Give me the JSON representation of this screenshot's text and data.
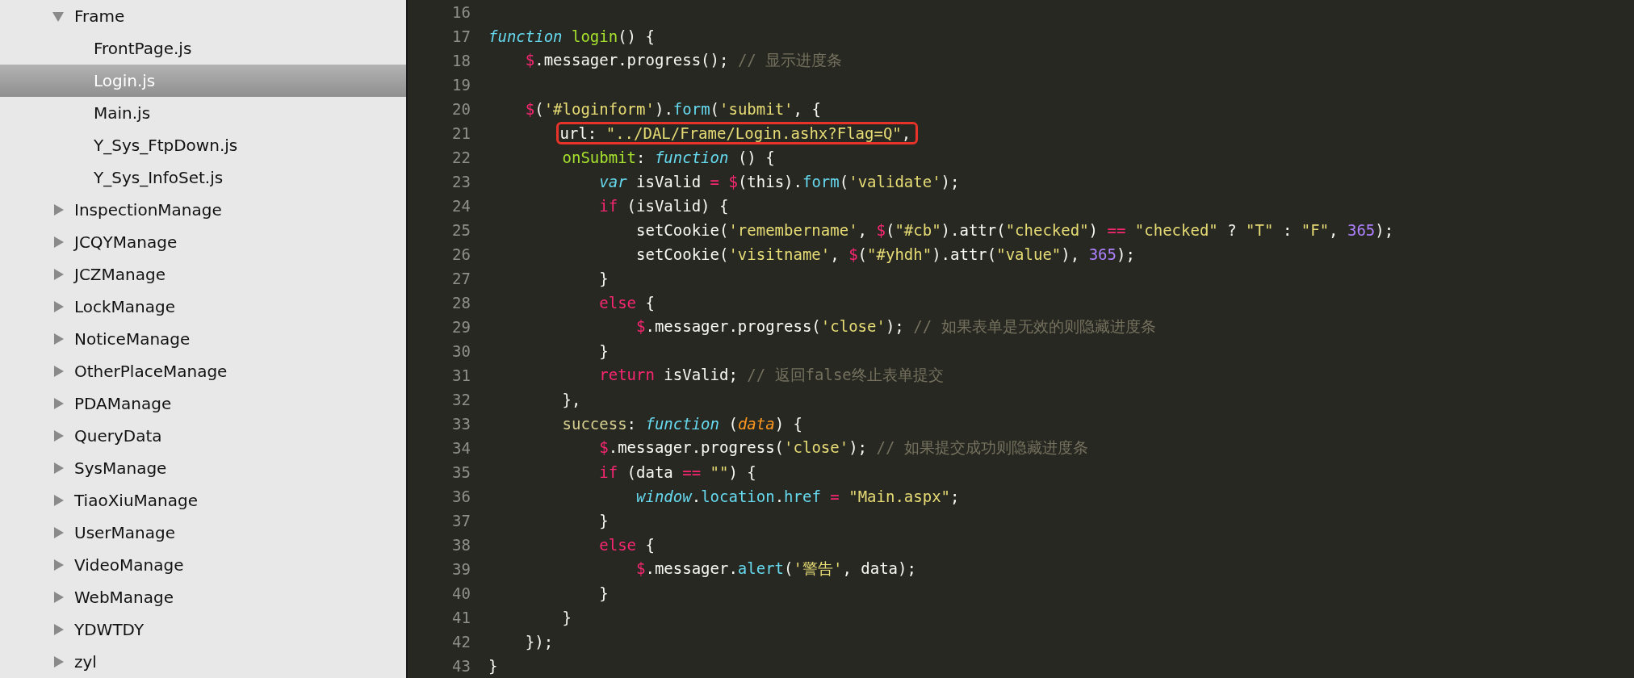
{
  "sidebar": {
    "tree": [
      {
        "label": "Frame",
        "kind": "folder",
        "expanded": true,
        "children": [
          {
            "label": "FrontPage.js",
            "kind": "file",
            "selected": false
          },
          {
            "label": "Login.js",
            "kind": "file",
            "selected": true
          },
          {
            "label": "Main.js",
            "kind": "file",
            "selected": false
          },
          {
            "label": "Y_Sys_FtpDown.js",
            "kind": "file",
            "selected": false
          },
          {
            "label": "Y_Sys_InfoSet.js",
            "kind": "file",
            "selected": false
          }
        ]
      },
      {
        "label": "InspectionManage",
        "kind": "folder",
        "expanded": false
      },
      {
        "label": "JCQYManage",
        "kind": "folder",
        "expanded": false
      },
      {
        "label": "JCZManage",
        "kind": "folder",
        "expanded": false
      },
      {
        "label": "LockManage",
        "kind": "folder",
        "expanded": false
      },
      {
        "label": "NoticeManage",
        "kind": "folder",
        "expanded": false
      },
      {
        "label": "OtherPlaceManage",
        "kind": "folder",
        "expanded": false
      },
      {
        "label": "PDAManage",
        "kind": "folder",
        "expanded": false
      },
      {
        "label": "QueryData",
        "kind": "folder",
        "expanded": false
      },
      {
        "label": "SysManage",
        "kind": "folder",
        "expanded": false
      },
      {
        "label": "TiaoXiuManage",
        "kind": "folder",
        "expanded": false
      },
      {
        "label": "UserManage",
        "kind": "folder",
        "expanded": false
      },
      {
        "label": "VideoManage",
        "kind": "folder",
        "expanded": false
      },
      {
        "label": "WebManage",
        "kind": "folder",
        "expanded": false
      },
      {
        "label": "YDWTDY",
        "kind": "folder",
        "expanded": false
      },
      {
        "label": "zyl",
        "kind": "folder",
        "expanded": false
      }
    ]
  },
  "editor": {
    "lines": [
      {
        "number": "16"
      },
      {
        "number": "17",
        "tokens": [
          {
            "t": "function",
            "kind": "storage"
          },
          {
            "t": " login",
            "kind": "entity"
          },
          {
            "t": "() {",
            "kind": "plain"
          }
        ]
      },
      {
        "number": "18",
        "tokens": [
          {
            "t": "    $",
            "kind": "keyword"
          },
          {
            "t": ".messager.progress(); ",
            "kind": "plain"
          },
          {
            "t": "// 显示进度条",
            "kind": "comment"
          }
        ]
      },
      {
        "number": "19"
      },
      {
        "number": "20",
        "tokens": [
          {
            "t": "    $",
            "kind": "keyword"
          },
          {
            "t": "(",
            "kind": "plain"
          },
          {
            "t": "'#loginform'",
            "kind": "string"
          },
          {
            "t": ").",
            "kind": "plain"
          },
          {
            "t": "form",
            "kind": "support"
          },
          {
            "t": "(",
            "kind": "plain"
          },
          {
            "t": "'submit'",
            "kind": "string"
          },
          {
            "t": ", {",
            "kind": "plain"
          }
        ]
      },
      {
        "number": "21",
        "annotated": true,
        "tokens": [
          {
            "t": "        url: ",
            "kind": "plain"
          },
          {
            "t": "\"../DAL/Frame/Login.ashx?Flag=Q\"",
            "kind": "string"
          },
          {
            "t": ",",
            "kind": "plain"
          }
        ]
      },
      {
        "number": "22",
        "tokens": [
          {
            "t": "        onSubmit",
            "kind": "entity"
          },
          {
            "t": ": ",
            "kind": "plain"
          },
          {
            "t": "function",
            "kind": "storage"
          },
          {
            "t": " () {",
            "kind": "plain"
          }
        ]
      },
      {
        "number": "23",
        "tokens": [
          {
            "t": "            var",
            "kind": "storage"
          },
          {
            "t": " isValid ",
            "kind": "plain"
          },
          {
            "t": "=",
            "kind": "keyword"
          },
          {
            "t": " $",
            "kind": "keyword"
          },
          {
            "t": "(this).",
            "kind": "plain"
          },
          {
            "t": "form",
            "kind": "support"
          },
          {
            "t": "(",
            "kind": "plain"
          },
          {
            "t": "'validate'",
            "kind": "string"
          },
          {
            "t": ");",
            "kind": "plain"
          }
        ]
      },
      {
        "number": "24",
        "tokens": [
          {
            "t": "            if",
            "kind": "keyword"
          },
          {
            "t": " (isValid) {",
            "kind": "plain"
          }
        ]
      },
      {
        "number": "25",
        "tokens": [
          {
            "t": "                setCookie(",
            "kind": "plain"
          },
          {
            "t": "'remembername'",
            "kind": "string"
          },
          {
            "t": ", ",
            "kind": "plain"
          },
          {
            "t": "$",
            "kind": "keyword"
          },
          {
            "t": "(",
            "kind": "plain"
          },
          {
            "t": "\"#cb\"",
            "kind": "string"
          },
          {
            "t": ").attr(",
            "kind": "plain"
          },
          {
            "t": "\"checked\"",
            "kind": "string"
          },
          {
            "t": ") ",
            "kind": "plain"
          },
          {
            "t": "==",
            "kind": "keyword"
          },
          {
            "t": " \"checked\"",
            "kind": "string"
          },
          {
            "t": " ? ",
            "kind": "plain"
          },
          {
            "t": "\"T\"",
            "kind": "string"
          },
          {
            "t": " : ",
            "kind": "plain"
          },
          {
            "t": "\"F\"",
            "kind": "string"
          },
          {
            "t": ", ",
            "kind": "plain"
          },
          {
            "t": "365",
            "kind": "number"
          },
          {
            "t": ");",
            "kind": "plain"
          }
        ]
      },
      {
        "number": "26",
        "tokens": [
          {
            "t": "                setCookie(",
            "kind": "plain"
          },
          {
            "t": "'visitname'",
            "kind": "string"
          },
          {
            "t": ", ",
            "kind": "plain"
          },
          {
            "t": "$",
            "kind": "keyword"
          },
          {
            "t": "(",
            "kind": "plain"
          },
          {
            "t": "\"#yhdh\"",
            "kind": "string"
          },
          {
            "t": ").attr(",
            "kind": "plain"
          },
          {
            "t": "\"value\"",
            "kind": "string"
          },
          {
            "t": "), ",
            "kind": "plain"
          },
          {
            "t": "365",
            "kind": "number"
          },
          {
            "t": ");",
            "kind": "plain"
          }
        ]
      },
      {
        "number": "27",
        "tokens": [
          {
            "t": "            }",
            "kind": "plain"
          }
        ]
      },
      {
        "number": "28",
        "tokens": [
          {
            "t": "            else",
            "kind": "keyword"
          },
          {
            "t": " {",
            "kind": "plain"
          }
        ]
      },
      {
        "number": "29",
        "tokens": [
          {
            "t": "                $",
            "kind": "keyword"
          },
          {
            "t": ".messager.progress(",
            "kind": "plain"
          },
          {
            "t": "'close'",
            "kind": "string"
          },
          {
            "t": "); ",
            "kind": "plain"
          },
          {
            "t": "// 如果表单是无效的则隐藏进度条",
            "kind": "comment"
          }
        ]
      },
      {
        "number": "30",
        "tokens": [
          {
            "t": "            }",
            "kind": "plain"
          }
        ]
      },
      {
        "number": "31",
        "tokens": [
          {
            "t": "            return",
            "kind": "keyword"
          },
          {
            "t": " isValid; ",
            "kind": "plain"
          },
          {
            "t": "// 返回false终止表单提交",
            "kind": "comment"
          }
        ]
      },
      {
        "number": "32",
        "tokens": [
          {
            "t": "        },",
            "kind": "plain"
          }
        ]
      },
      {
        "number": "33",
        "tokens": [
          {
            "t": "        success",
            "kind": "label"
          },
          {
            "t": ": ",
            "kind": "plain"
          },
          {
            "t": "function",
            "kind": "storage"
          },
          {
            "t": " (",
            "kind": "plain"
          },
          {
            "t": "data",
            "kind": "param"
          },
          {
            "t": ") {",
            "kind": "plain"
          }
        ]
      },
      {
        "number": "34",
        "tokens": [
          {
            "t": "            $",
            "kind": "keyword"
          },
          {
            "t": ".messager.progress(",
            "kind": "plain"
          },
          {
            "t": "'close'",
            "kind": "string"
          },
          {
            "t": "); ",
            "kind": "plain"
          },
          {
            "t": "// 如果提交成功则隐藏进度条",
            "kind": "comment"
          }
        ]
      },
      {
        "number": "35",
        "tokens": [
          {
            "t": "            if",
            "kind": "keyword"
          },
          {
            "t": " (data ",
            "kind": "plain"
          },
          {
            "t": "==",
            "kind": "keyword"
          },
          {
            "t": " \"\"",
            "kind": "string"
          },
          {
            "t": ") {",
            "kind": "plain"
          }
        ]
      },
      {
        "number": "36",
        "tokens": [
          {
            "t": "                window",
            "kind": "storage"
          },
          {
            "t": ".",
            "kind": "plain"
          },
          {
            "t": "location",
            "kind": "support"
          },
          {
            "t": ".",
            "kind": "plain"
          },
          {
            "t": "href",
            "kind": "support"
          },
          {
            "t": " =",
            "kind": "keyword"
          },
          {
            "t": " \"Main.aspx\"",
            "kind": "string"
          },
          {
            "t": ";",
            "kind": "plain"
          }
        ]
      },
      {
        "number": "37",
        "tokens": [
          {
            "t": "            }",
            "kind": "plain"
          }
        ]
      },
      {
        "number": "38",
        "tokens": [
          {
            "t": "            else",
            "kind": "keyword"
          },
          {
            "t": " {",
            "kind": "plain"
          }
        ]
      },
      {
        "number": "39",
        "tokens": [
          {
            "t": "                $",
            "kind": "keyword"
          },
          {
            "t": ".messager.",
            "kind": "plain"
          },
          {
            "t": "alert",
            "kind": "support"
          },
          {
            "t": "(",
            "kind": "plain"
          },
          {
            "t": "'警告'",
            "kind": "string"
          },
          {
            "t": ", data);",
            "kind": "plain"
          }
        ]
      },
      {
        "number": "40",
        "tokens": [
          {
            "t": "            }",
            "kind": "plain"
          }
        ]
      },
      {
        "number": "41",
        "tokens": [
          {
            "t": "        }",
            "kind": "plain"
          }
        ]
      },
      {
        "number": "42",
        "tokens": [
          {
            "t": "    });",
            "kind": "plain"
          }
        ]
      },
      {
        "number": "43",
        "tokens": [
          {
            "t": "}",
            "kind": "plain"
          }
        ]
      }
    ]
  }
}
